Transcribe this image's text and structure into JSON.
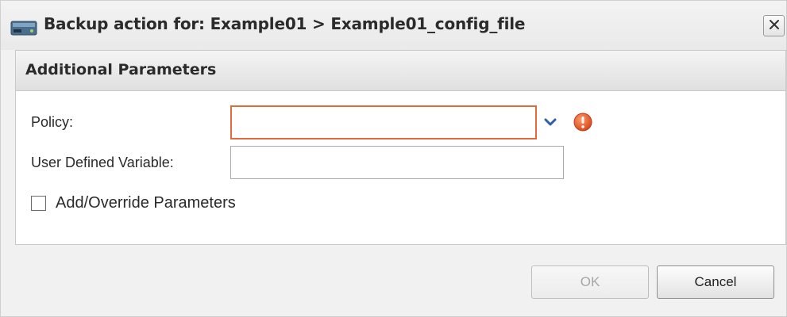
{
  "dialog": {
    "title": "Backup action for: Example01 > Example01_config_file",
    "title_icon": "drive-icon",
    "close_icon": "close-icon"
  },
  "panel": {
    "title": "Additional Parameters"
  },
  "form": {
    "policy": {
      "label": "Policy:",
      "value": "",
      "state": "error",
      "error_color": "#e06a3a"
    },
    "user_defined_variable": {
      "label": "User Defined Variable:",
      "value": ""
    },
    "add_override": {
      "label": "Add/Override Parameters",
      "checked": false
    }
  },
  "buttons": {
    "ok_label": "OK",
    "ok_enabled": false,
    "cancel_label": "Cancel"
  },
  "colors": {
    "error": "#e06a3a",
    "accent": "#2e5fa8"
  }
}
